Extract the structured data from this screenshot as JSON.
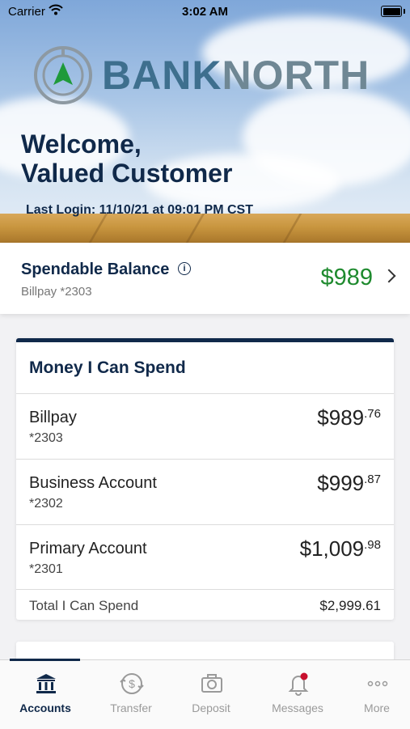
{
  "status_bar": {
    "carrier": "Carrier",
    "time": "3:02 AM"
  },
  "brand": {
    "name_part1": "BANK",
    "name_part2": "NORTH"
  },
  "hero": {
    "welcome_line1": "Welcome,",
    "welcome_line2": "Valued Customer",
    "last_login": "Last Login: 11/10/21 at 09:01 PM CST"
  },
  "spendable": {
    "title": "Spendable Balance",
    "subtitle": "Billpay *2303",
    "amount": "$989"
  },
  "money_card": {
    "title": "Money I Can Spend",
    "accounts": [
      {
        "name": "Billpay",
        "number": "*2303",
        "balance_main": "$989",
        "balance_cents": ".76"
      },
      {
        "name": "Business Account",
        "number": "*2302",
        "balance_main": "$999",
        "balance_cents": ".87"
      },
      {
        "name": "Primary Account",
        "number": "*2301",
        "balance_main": "$1,009",
        "balance_cents": ".98"
      }
    ],
    "total_label": "Total I Can Spend",
    "total_value": "$2,999.61"
  },
  "tabs": [
    {
      "label": "Accounts",
      "icon": "bank-icon",
      "active": true
    },
    {
      "label": "Transfer",
      "icon": "transfer-icon",
      "active": false
    },
    {
      "label": "Deposit",
      "icon": "camera-icon",
      "active": false
    },
    {
      "label": "Messages",
      "icon": "bell-icon",
      "active": false
    },
    {
      "label": "More",
      "icon": "more-icon",
      "active": false
    }
  ],
  "colors": {
    "navy": "#10294a",
    "green": "#1e8a2e",
    "brand_blue": "#3e6f8e",
    "brand_grey": "#6f8794",
    "badge_red": "#c8102e"
  }
}
